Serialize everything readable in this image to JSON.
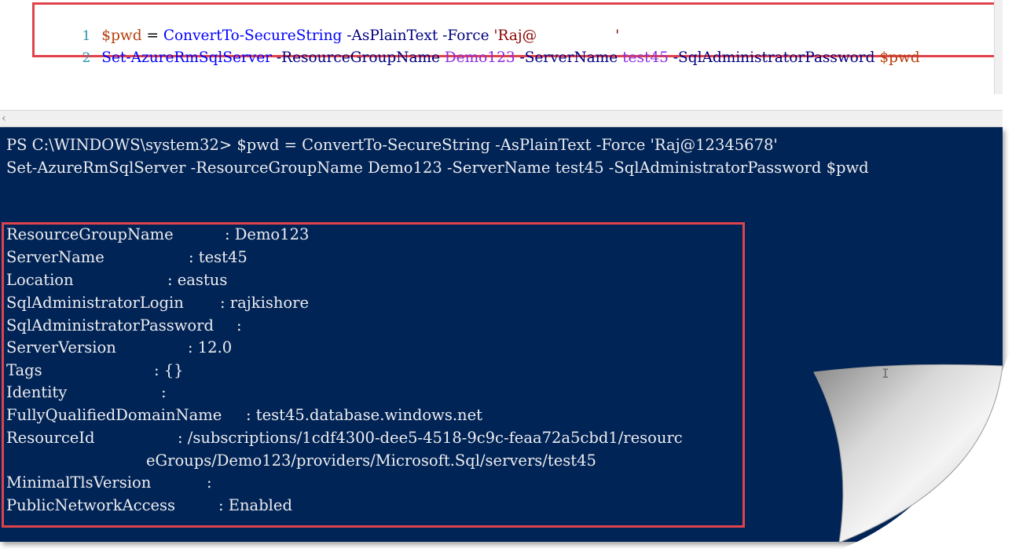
{
  "editor": {
    "lines": [
      {
        "number": "1",
        "var": "$pwd",
        "op": " = ",
        "cmd": "ConvertTo-SecureString",
        "p1": " -AsPlainText",
        "p2": " -Force",
        "str_open": " 'Raj@",
        "str_close": "'"
      },
      {
        "number": "2",
        "cmd": "Set-AzureRmSqlServer",
        "p1": " -ResourceGroupName",
        "v1": " Demo123",
        "p2": " -ServerName",
        "v2": " test45",
        "p3": " -SqlAdministratorPassword",
        "v3": " $pwd"
      }
    ]
  },
  "console": {
    "prompt_line": "PS C:\\WINDOWS\\system32> $pwd = ConvertTo-SecureString -AsPlainText -Force 'Raj@12345678'",
    "second_line": "Set-AzureRmSqlServer -ResourceGroupName Demo123 -ServerName test45 -SqlAdministratorPassword $pwd",
    "output": [
      {
        "name": "ResourceGroupName",
        "value": ": Demo123"
      },
      {
        "name": "ServerName",
        "value": ": test45"
      },
      {
        "name": "Location",
        "value": ": eastus"
      },
      {
        "name": "SqlAdministratorLogin",
        "value": ": rajkishore"
      },
      {
        "name": "SqlAdministratorPassword",
        "value": ":"
      },
      {
        "name": "ServerVersion",
        "value": ": 12.0"
      },
      {
        "name": "Tags",
        "value": ": {}"
      },
      {
        "name": "Identity",
        "value": ":"
      },
      {
        "name": "FullyQualifiedDomainName",
        "value": ": test45.database.windows.net"
      },
      {
        "name": "ResourceId",
        "value": ": /subscriptions/1cdf4300-dee5-4518-9c9c-feaa72a5cbd1/resourc"
      },
      {
        "name": "",
        "value": "eGroups/Demo123/providers/Microsoft.Sql/servers/test45"
      },
      {
        "name": "MinimalTlsVersion",
        "value": ":"
      },
      {
        "name": "PublicNetworkAccess",
        "value": ": Enabled"
      }
    ]
  },
  "colors": {
    "console_bg": "#012456",
    "highlight_border": "#e0434c"
  }
}
